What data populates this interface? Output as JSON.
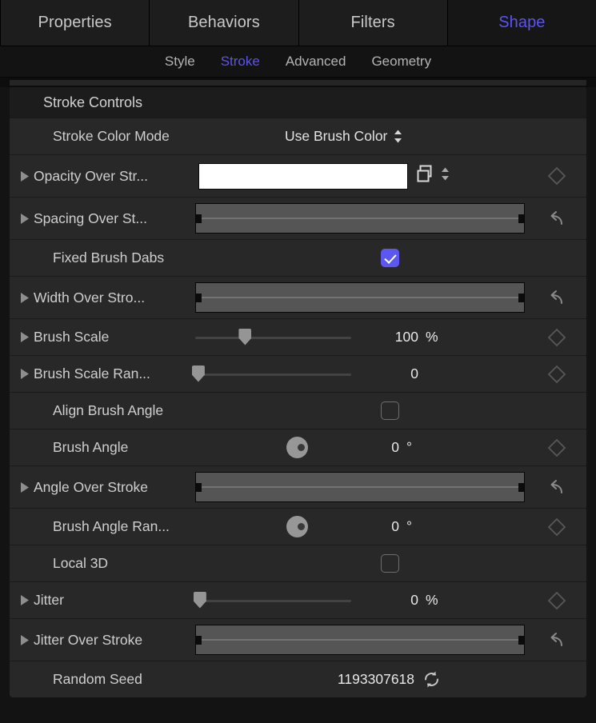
{
  "tabs": [
    {
      "label": "Properties",
      "active": false
    },
    {
      "label": "Behaviors",
      "active": false
    },
    {
      "label": "Filters",
      "active": false
    },
    {
      "label": "Shape",
      "active": true
    }
  ],
  "subtabs": [
    {
      "label": "Style",
      "active": false
    },
    {
      "label": "Stroke",
      "active": true
    },
    {
      "label": "Advanced",
      "active": false
    },
    {
      "label": "Geometry",
      "active": false
    }
  ],
  "group": {
    "title": "Stroke Controls"
  },
  "rows": {
    "stroke_color_mode": {
      "label": "Stroke Color Mode",
      "value": "Use Brush Color"
    },
    "opacity_over_stroke": {
      "label": "Opacity Over Str..."
    },
    "spacing_over_stroke": {
      "label": "Spacing Over St..."
    },
    "fixed_brush_dabs": {
      "label": "Fixed Brush Dabs",
      "checked": true
    },
    "width_over_stroke": {
      "label": "Width Over Stro..."
    },
    "brush_scale": {
      "label": "Brush Scale",
      "value": "100",
      "unit": "%"
    },
    "brush_scale_randomness": {
      "label": "Brush Scale Ran...",
      "value": "0",
      "unit": ""
    },
    "align_brush_angle": {
      "label": "Align Brush Angle",
      "checked": false
    },
    "brush_angle": {
      "label": "Brush Angle",
      "value": "0",
      "unit": "°"
    },
    "angle_over_stroke": {
      "label": "Angle Over Stroke"
    },
    "brush_angle_randomness": {
      "label": "Brush Angle Ran...",
      "value": "0",
      "unit": "°"
    },
    "local_3d": {
      "label": "Local 3D",
      "checked": false
    },
    "jitter": {
      "label": "Jitter",
      "value": "0",
      "unit": "%"
    },
    "jitter_over_stroke": {
      "label": "Jitter Over Stroke"
    },
    "random_seed": {
      "label": "Random Seed",
      "value": "1193307618"
    }
  },
  "colors": {
    "accent": "#5b54ef",
    "checkbox_on": "#5d57f2",
    "panel_bg": "#1c1c1c",
    "row_bg": "#282828",
    "text": "#cfcfcf"
  }
}
